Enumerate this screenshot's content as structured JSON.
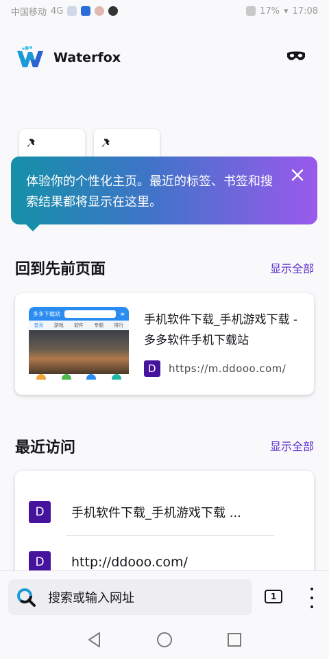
{
  "status_bar": {
    "carrier": "中国移动",
    "signal": "4G",
    "battery": "17%",
    "time": "17:08"
  },
  "header": {
    "app_name": "Waterfox"
  },
  "onboarding_tip": {
    "text": "体验你的个性化主页。最近的标签、书签和搜索结果都将显示在这里。"
  },
  "jump_back": {
    "title": "回到先前页面",
    "show_all": "显示全部",
    "item": {
      "title": "手机软件下载_手机游戏下载 - 多多软件手机下载站",
      "favicon_letter": "D",
      "url": "https://m.ddooo.com/",
      "thumb_site": "多多下载站",
      "thumb_nav": [
        "首页",
        "游戏",
        "软件",
        "专题",
        "排行"
      ]
    }
  },
  "recent": {
    "title": "最近访问",
    "show_all": "显示全部",
    "items": [
      {
        "favicon_letter": "D",
        "label": "手机软件下载_手机游戏下载 ..."
      },
      {
        "favicon_letter": "D",
        "label": "http://ddooo.com/"
      }
    ]
  },
  "toolbar": {
    "search_placeholder": "搜索或输入网址",
    "tab_count": "1"
  },
  "colors": {
    "accent": "#592acb",
    "favicon_bg": "#45139c",
    "tip_gradient_start": "#1590a8",
    "tip_gradient_end": "#9b59ec"
  }
}
